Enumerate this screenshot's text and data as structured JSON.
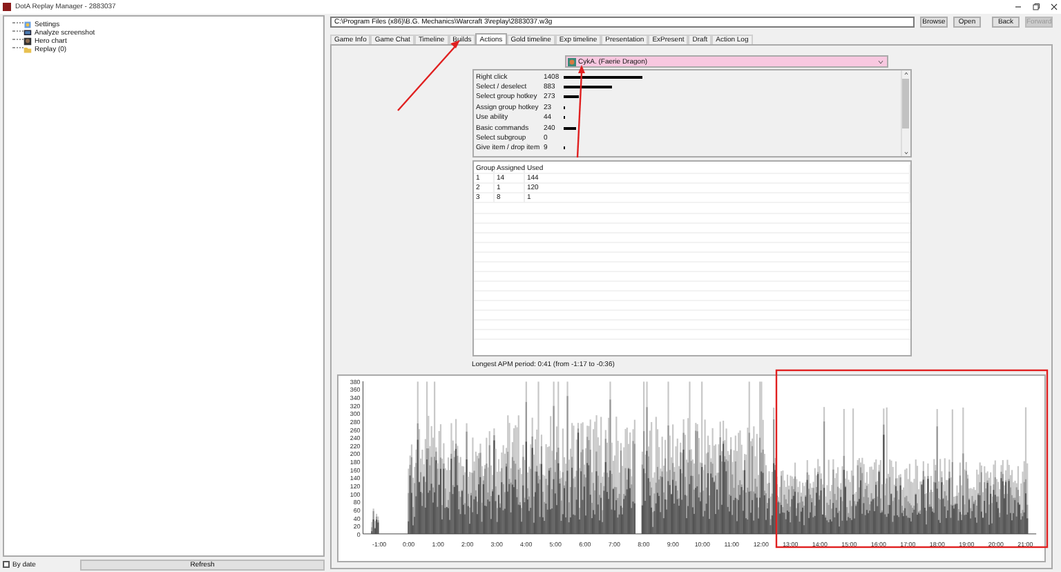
{
  "window": {
    "title": "DotA Replay Manager - 2883037"
  },
  "sidebar": {
    "items": [
      {
        "label": "Settings",
        "kind": "settings"
      },
      {
        "label": "Analyze screenshot",
        "kind": "screenshot"
      },
      {
        "label": "Hero chart",
        "kind": "chart"
      },
      {
        "label": "Replay (0)",
        "kind": "folder"
      }
    ]
  },
  "sidebar_footer": {
    "by_date": {
      "label": "By date",
      "checked": false
    },
    "refresh": "Refresh"
  },
  "path_field": {
    "value": "C:\\Program Files (x86)\\B.G. Mechanics\\Warcraft 3\\replay\\2883037.w3g"
  },
  "buttons": [
    {
      "label": "Browse",
      "disabled": false
    },
    {
      "label": "Open",
      "disabled": false
    },
    {
      "label": "Back",
      "disabled": false
    },
    {
      "label": "Forward",
      "disabled": true
    }
  ],
  "tabs": [
    {
      "label": "Game Info",
      "selected": false
    },
    {
      "label": "Game Chat",
      "selected": false
    },
    {
      "label": "Timeline",
      "selected": false
    },
    {
      "label": "Builds",
      "selected": false
    },
    {
      "label": "Actions",
      "selected": true
    },
    {
      "label": "Gold timeline",
      "selected": false
    },
    {
      "label": "Exp timeline",
      "selected": false
    },
    {
      "label": "Presentation",
      "selected": false
    },
    {
      "label": "ExPresent",
      "selected": false
    },
    {
      "label": "Draft",
      "selected": false
    },
    {
      "label": "Action Log",
      "selected": false
    }
  ],
  "hero_select": {
    "value": "CykA. (Faerie Dragon)"
  },
  "actions": [
    {
      "name": "Right click",
      "count": "1408"
    },
    {
      "name": "Select / deselect",
      "count": "883"
    },
    {
      "name": "Select group hotkey",
      "count": "273"
    },
    {
      "name": "Assign group hotkey",
      "count": "23"
    },
    {
      "name": "Use ability",
      "count": "44"
    },
    {
      "name": "Basic commands",
      "count": "240"
    },
    {
      "name": "Select subgroup",
      "count": "0"
    },
    {
      "name": "Give item / drop item",
      "count": "9"
    }
  ],
  "groups": {
    "columns": [
      "Group",
      "Assigned",
      "Used"
    ],
    "rows": [
      [
        "1",
        "14",
        "144"
      ],
      [
        "2",
        "1",
        "120"
      ],
      [
        "3",
        "8",
        "1"
      ]
    ]
  },
  "status": "Longest APM period: 0:41 (from -1:17 to -0:36)",
  "apm_chart": {
    "y_labels": [
      "380",
      "360",
      "340",
      "320",
      "300",
      "280",
      "260",
      "240",
      "220",
      "200",
      "180",
      "160",
      "140",
      "120",
      "100",
      "80",
      "60",
      "40",
      "20",
      "0"
    ],
    "x_labels": [
      "-1:00",
      "0:00",
      "1:00",
      "2:00",
      "3:00",
      "4:00",
      "5:00",
      "6:00",
      "7:00",
      "8:00",
      "9:00",
      "10:00",
      "11:00",
      "12:00",
      "13:00",
      "14:00",
      "15:00",
      "16:00",
      "17:00",
      "18:00",
      "19:00",
      "20:00",
      "21:00"
    ]
  }
}
